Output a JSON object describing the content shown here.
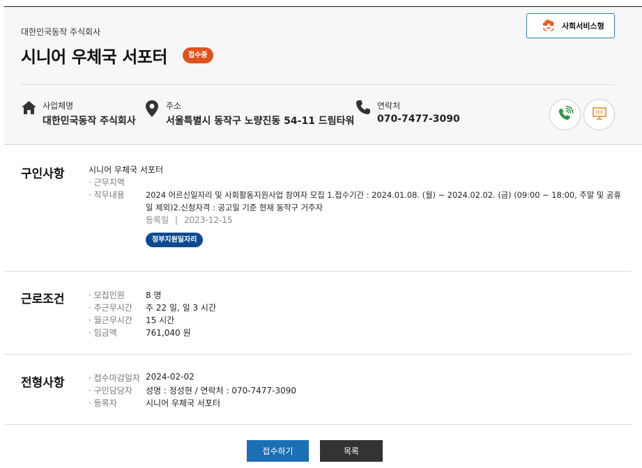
{
  "header": {
    "company_small": "대한민국동작 주식회사",
    "title": "시니어 우체국 서포터",
    "status_badge": "접수중",
    "type_button": "사회서비스형"
  },
  "info": {
    "business": {
      "label": "사업체명",
      "value": "대한민국동작 주식회사"
    },
    "address": {
      "label": "주소",
      "value": "서울특별시 동작구 노량진동 54-11 드림타워"
    },
    "contact": {
      "label": "연락처",
      "value": "070-7477-3090"
    }
  },
  "job": {
    "title": "구인사항",
    "name": "시니어 우체국 서포터",
    "area_label": "· 근무지역",
    "area_value": "",
    "duty_label": "· 직무내용",
    "duty_line1": "2024 어르신일자리 및 사회활동지원사업 참여자 모집 1.접수기간 : 2024.01.08. (월) ~ 2024.02.02. (금) (09:00 ~ 18:00, 주말 및 공휴",
    "duty_line2": "일 제외)2.신청자격 :  공고일 기준 현재 동작구 거주자",
    "reg_label": "등록일",
    "reg_sep": "|",
    "reg_date": "2023-12-15",
    "tag": "정부지원일자리"
  },
  "conditions": {
    "title": "근로조건",
    "rows": [
      {
        "key": "· 모집인원",
        "value": "8 명"
      },
      {
        "key": "· 주근무시간",
        "value": "주 22 일, 일 3 시간"
      },
      {
        "key": "· 월근무시간",
        "value": "15 시간"
      },
      {
        "key": "· 임금액",
        "value": "761,040 원"
      }
    ]
  },
  "selection": {
    "title": "전형사항",
    "rows": [
      {
        "key": "· 접수마감일자",
        "value": "2024-02-02"
      },
      {
        "key": "· 구인담당자",
        "value": "성명 : 정성현 / 연락처 : 070-7477-3090"
      },
      {
        "key": "· 등록자",
        "value": "시니어 우체국 서포터"
      }
    ]
  },
  "buttons": {
    "apply": "접수하기",
    "list": "목록"
  },
  "icons": {
    "home": "home-icon",
    "location": "location-pin-icon",
    "phone": "phone-icon",
    "call": "call-icon",
    "monitor": "monitor-icon",
    "cloud": "cloud-person-icon"
  },
  "colors": {
    "status_badge": "#e0521c",
    "gov_tag": "#0b4a8f",
    "apply_button": "#1a6fb5",
    "list_button": "#333333",
    "call_icon": "#2e9a3c",
    "monitor_icon": "#e58a1c"
  }
}
